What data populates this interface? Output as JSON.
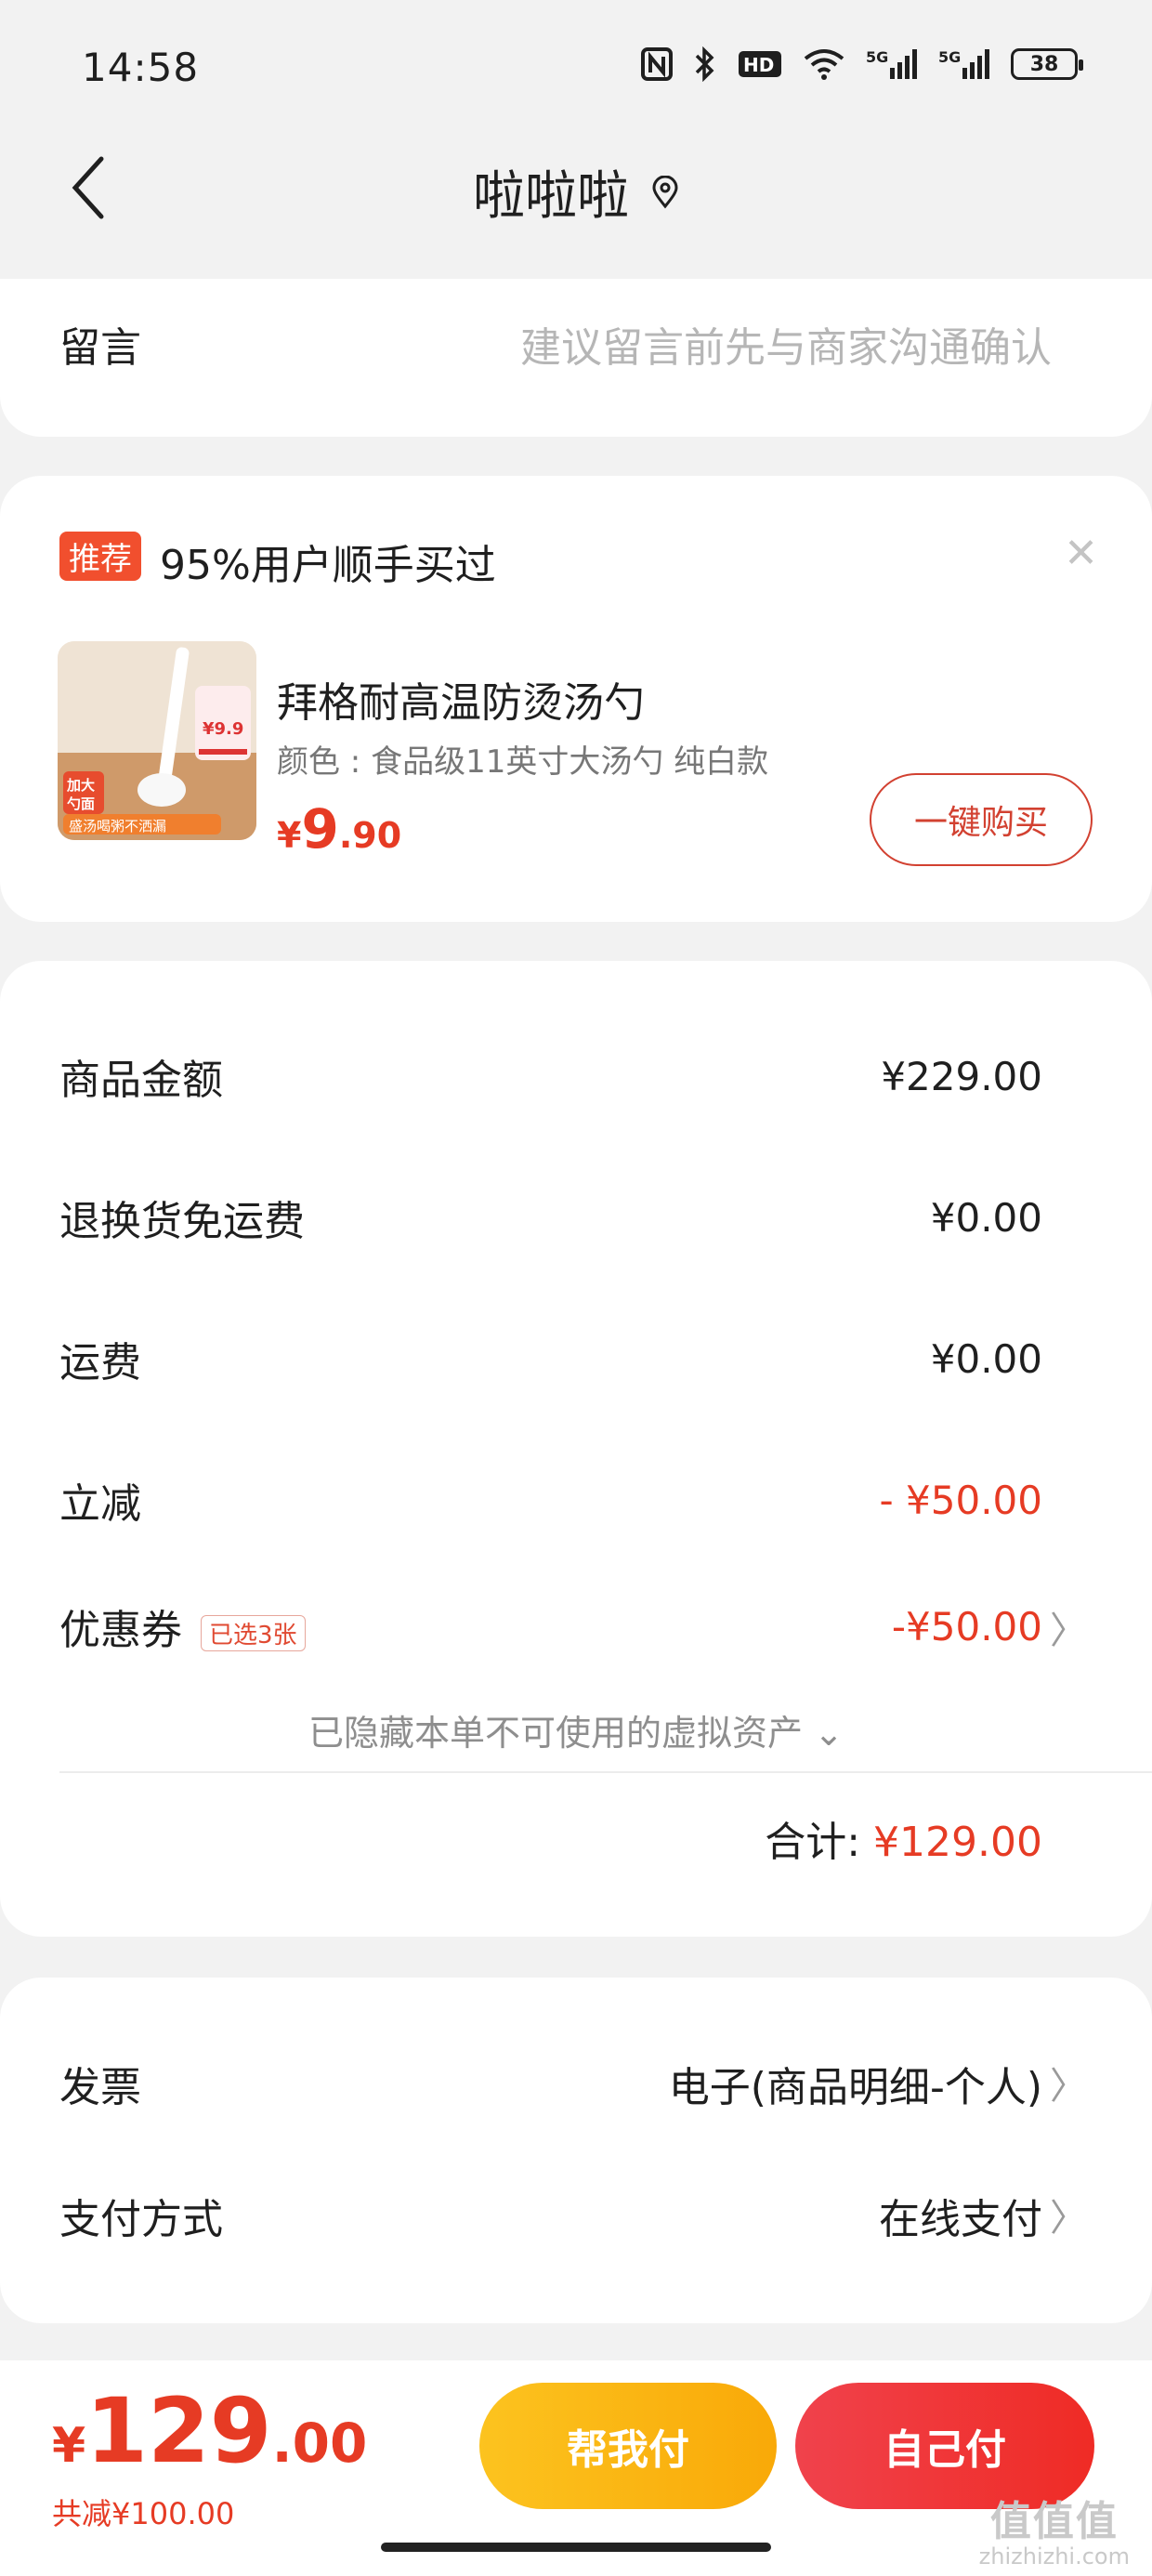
{
  "status_bar": {
    "time": "14:58",
    "battery": "38",
    "signal_1": "5G",
    "signal_2": "5G",
    "hd": "HD"
  },
  "nav": {
    "title": "啦啦啦"
  },
  "message": {
    "label": "留言",
    "placeholder": "建议留言前先与商家沟通确认"
  },
  "recommend": {
    "badge": "推荐",
    "title": "95%用户顺手买过",
    "product_name": "拜格耐高温防烫汤勺",
    "product_spec": "颜色 : 食品级11英寸大汤勺 纯白款",
    "price_currency": "¥",
    "price_int": "9",
    "price_dec": ".90",
    "buy_label": "一键购买",
    "img_texts": {
      "tag1": "加大",
      "tag2": "勺面",
      "bottom": "盛汤喝粥不洒漏",
      "price": "¥9.9"
    }
  },
  "summary": {
    "items": [
      {
        "label": "商品金额",
        "value": "¥229.00"
      },
      {
        "label": "退换货免运费",
        "value": "¥0.00"
      },
      {
        "label": "运费",
        "value": "¥0.00"
      },
      {
        "label": "立减",
        "value": "- ¥50.00"
      }
    ],
    "coupon": {
      "label": "优惠券",
      "tag": "已选3张",
      "value": "-¥50.00"
    },
    "hidden_note": "已隐藏本单不可使用的虚拟资产",
    "total_label": "合计:",
    "total_value": "¥129.00"
  },
  "payment": {
    "invoice_label": "发票",
    "invoice_value": "电子(商品明细-个人)",
    "method_label": "支付方式",
    "method_value": "在线支付"
  },
  "bottom": {
    "price_currency": "¥",
    "price_int": "129",
    "price_dec": ".00",
    "saved": "共减¥100.00",
    "help_pay": "帮我付",
    "self_pay": "自己付"
  },
  "watermark": {
    "big": "值值值",
    "small": "zhizhizhi.com"
  },
  "colors": {
    "accent": "#e63b24",
    "help_btn": "#fcc31f",
    "self_btn": "#ef2b25"
  }
}
